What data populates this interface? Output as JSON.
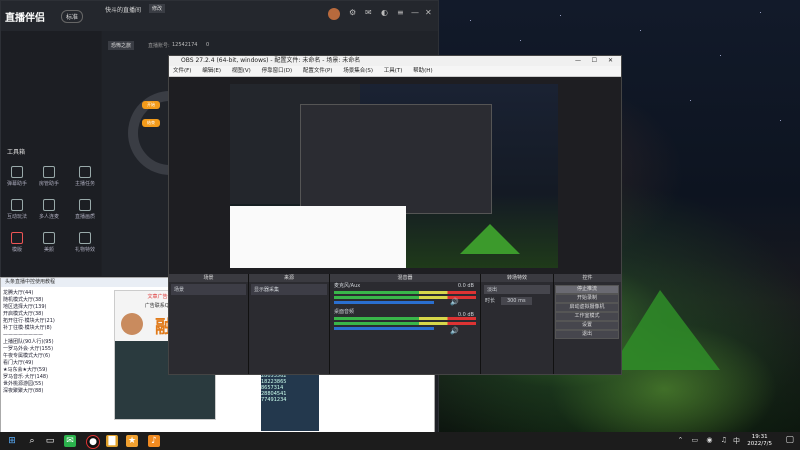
{
  "zb": {
    "app_name": "直播伴侣",
    "badge": "标准",
    "room_title": "快斗的直播间",
    "room_edit": "修改",
    "room_tag": "恐怖之旅",
    "room_id_label": "直播账号:",
    "room_id": "12542174",
    "online_count": "0",
    "tools_title": "工具箱",
    "tools": [
      "弹幕助手",
      "房管助手",
      "主播任务",
      "互动玩法",
      "多人连麦",
      "直播画质",
      "模版",
      "美颜",
      "礼物特效"
    ],
    "start_btn": "开始",
    "stop_btn": "结束"
  },
  "chat": {
    "title": "头条直播中控使用教程",
    "list": [
      "龙腾大厅(44)",
      "随机模式大厅(38)",
      "地区选择大厅(139)",
      "开启模式大厅(38)",
      "拓开往行·模块大厅(21)",
      "补丁往模·模块大厅(8)",
      "————————",
      "上播团队(90人行)(95)",
      "一罗马外会·大厅(155)",
      "午夜专属模式大厅(6)",
      "看门大厅(49)",
      "★马东会★大厅(59)",
      "罗马音乐·大厅(148)",
      "世外桃源游园(55)",
      "深夜聚聚大厅(88)"
    ],
    "ad_title": "文章广告位招租",
    "ad_qq": "广告联系QQ1915",
    "ad_char": "融",
    "numbers": [
      "28053562",
      "18223865",
      "8657314",
      "28804541",
      "77491234"
    ]
  },
  "obs": {
    "title": "OBS 27.2.4 (64-bit, windows) - 配置文件: 未命名 - 场景: 未命名",
    "menu": [
      "文件(F)",
      "编辑(E)",
      "视图(V)",
      "停靠窗口(D)",
      "配置文件(P)",
      "场景集合(S)",
      "工具(T)",
      "帮助(H)"
    ],
    "docks": {
      "scenes": "场景",
      "sources": "来源",
      "mixer": "混音器",
      "transitions": "转场特效",
      "controls": "控件"
    },
    "scene_item": "场景",
    "source_item": "显示器采集",
    "mixer_ch1": "麦克风/Aux",
    "mixer_ch2": "桌面音频",
    "mixer_db1": "0.0 dB",
    "mixer_db2": "0.0 dB",
    "transition": "淡出",
    "duration_label": "时长",
    "duration": "300 ms",
    "controls": [
      "停止推流",
      "开始录制",
      "启动虚拟摄像机",
      "工作室模式",
      "设置",
      "退出"
    ]
  },
  "taskbar": {
    "time": "19:31",
    "date": "2022/7/5",
    "ime": "中",
    "lang": "英"
  }
}
